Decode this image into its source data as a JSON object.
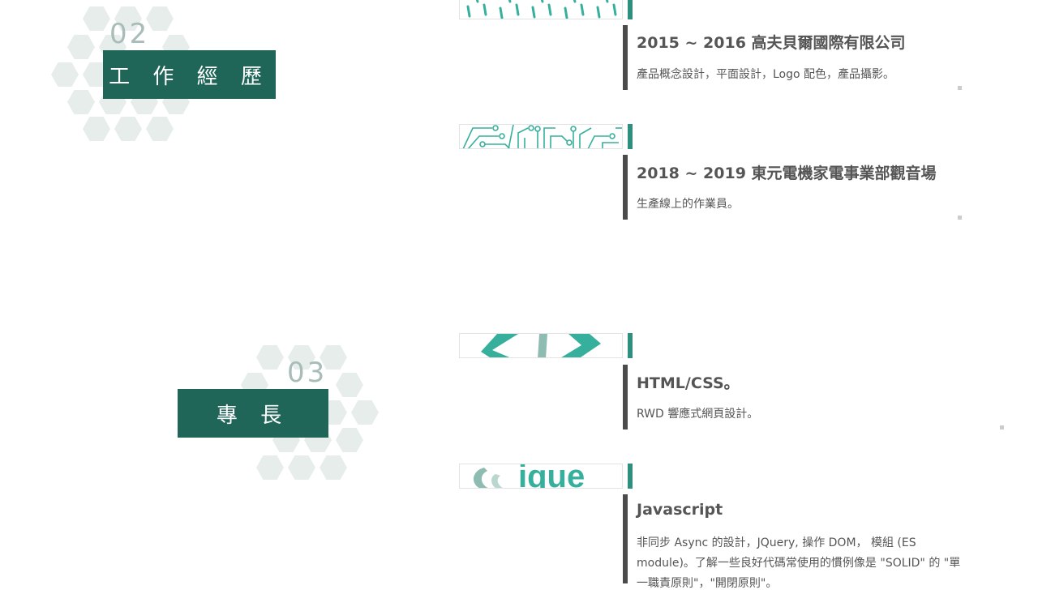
{
  "sections": {
    "experience": {
      "number": "02",
      "title": "工 作 經 歷"
    },
    "skills": {
      "number": "03",
      "title": "專 長"
    }
  },
  "experience": [
    {
      "title": "2015 ~ 2016 高夫貝爾國際有限公司",
      "desc": "產品概念設計，平面設計，Logo 配色，產品攝影。",
      "thumb_icon": "dashes-pattern-icon"
    },
    {
      "title": "2018 ~ 2019 東元電機家電事業部觀音場",
      "desc": "生產線上的作業員。",
      "thumb_icon": "circuit-pattern-icon"
    }
  ],
  "skills": [
    {
      "title": "HTML/CSS。",
      "desc": "RWD 響應式網頁設計。",
      "thumb_icon": "code-brackets-icon"
    },
    {
      "title": "Javascript",
      "desc": "非同步 Async 的設計，JQuery, 操作 DOM， 模組 (ES module)。了解一些良好代碼常使用的慣例像是 \"SOLID\" 的 \"單一職責原則\"，\"開閉原則\"。",
      "thumb_icon": "jquery-logo-icon",
      "thumb_text": "ique"
    }
  ],
  "colors": {
    "section_box": "#1f6659",
    "accent": "#2e8f7f",
    "teal": "#36b09c",
    "hex": "#e6edeb"
  }
}
